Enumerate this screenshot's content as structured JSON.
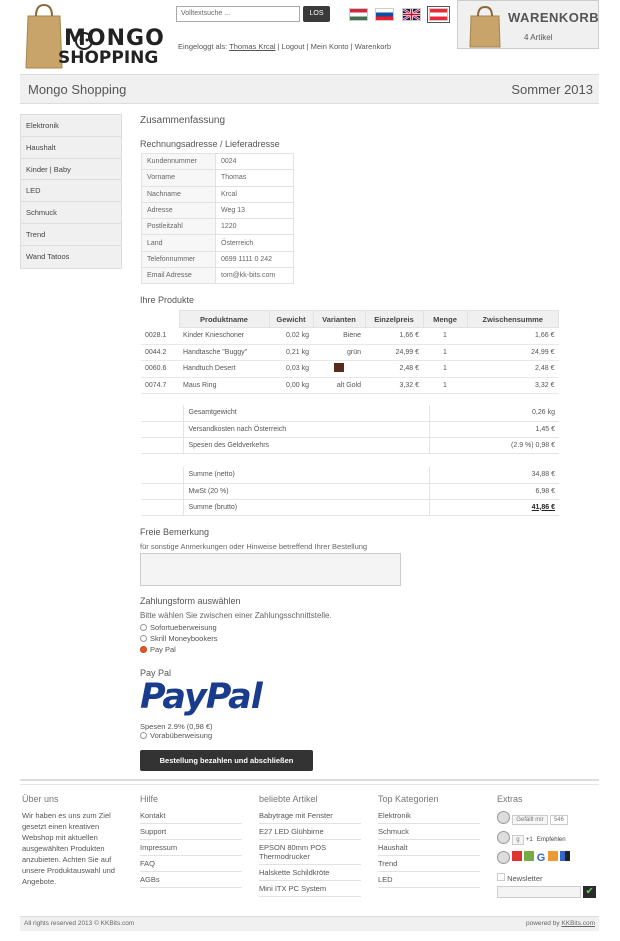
{
  "header": {
    "logo_text_top": "MONGO",
    "logo_text_bottom": "SHOPPING",
    "search_placeholder": "Volltextsuche ...",
    "search_button": "LOS",
    "flags": [
      "hungary",
      "slovakia",
      "united-kingdom",
      "austria"
    ],
    "login_prefix": "Eingeloggt als:",
    "login_user": "Thomas Krcal",
    "logout": "Logout",
    "my_account": "Mein Konto",
    "cart_link": "Warenkorb",
    "cart_title": "WARENKORB",
    "cart_count": "4 Artikel"
  },
  "titlebar": {
    "left": "Mongo Shopping",
    "right": "Sommer 2013"
  },
  "sidebar": {
    "items": [
      "Elektronik",
      "Haushalt",
      "Kinder | Baby",
      "LED",
      "Schmuck",
      "Trend",
      "Wand Tatoos"
    ]
  },
  "main": {
    "heading": "Zusammenfassung",
    "address_heading": "Rechnungsadresse / Lieferadresse",
    "address": [
      {
        "label": "Kundennummer",
        "value": "0024"
      },
      {
        "label": "Vorname",
        "value": "Thomas"
      },
      {
        "label": "Nachname",
        "value": "Krcal"
      },
      {
        "label": "Adresse",
        "value": "Weg 13"
      },
      {
        "label": "Postleitzahl",
        "value": "1220"
      },
      {
        "label": "Land",
        "value": "Österreich"
      },
      {
        "label": "Telefonnummer",
        "value": "0699 1111 0 242"
      },
      {
        "label": "Email Adresse",
        "value": "tom@kk-bits.com"
      }
    ],
    "products_heading": "Ihre Produkte",
    "products_columns": [
      "Produktname",
      "Gewicht",
      "Varianten",
      "Einzelpreis",
      "Menge",
      "Zwischensumme"
    ],
    "products": [
      {
        "nr": "0028.1",
        "name": "Kinder Knieschoner",
        "weight": "0,02 kg",
        "variant": "Biene",
        "price": "1,66 €",
        "qty": "1",
        "subtotal": "1,66 €"
      },
      {
        "nr": "0044.2",
        "name": "Handtasche \"Buggy\"",
        "weight": "0,21 kg",
        "variant": "grün",
        "price": "24,99 €",
        "qty": "1",
        "subtotal": "24,99 €"
      },
      {
        "nr": "0060.6",
        "name": "Handtuch Desert",
        "weight": "0,03 kg",
        "variant": "",
        "price": "2,48 €",
        "qty": "1",
        "subtotal": "2,48 €"
      },
      {
        "nr": "0074.7",
        "name": "Maus Ring",
        "weight": "0,00 kg",
        "variant": "alt Gold",
        "price": "3,32 €",
        "qty": "1",
        "subtotal": "3,32 €"
      }
    ],
    "variant_swatch_color": "#5a2b1a",
    "summary_a": [
      {
        "label": "Gesamtgewicht",
        "value": "0,26 kg"
      },
      {
        "label": "Versandkosten nach Österreich",
        "value": "1,45 €"
      },
      {
        "label": "Spesen des Geldverkehrs",
        "value": "(2.9 %) 0,98 €"
      }
    ],
    "summary_b": [
      {
        "label": "Summe (netto)",
        "value": "34,88 €"
      },
      {
        "label": "MwSt (20 %)",
        "value": "6,98 €"
      },
      {
        "label": "Summe (brutto)",
        "value": "41,86 €"
      }
    ],
    "remark_heading": "Freie Bemerkung",
    "remark_hint": "für sonstige Anmerkungen oder Hinweise betreffend Ihrer Bestellung",
    "payment_heading": "Zahlungsform auswählen",
    "payment_hint": "Bitte wählen Sie zwischen einer Zahlungsschnittstelle.",
    "payment_options": [
      "Sofortueberweisung",
      "Skrill Moneybookers",
      "Pay Pal"
    ],
    "payment_selected": "Pay Pal",
    "paypal_label": "Pay Pal",
    "paypal_logo_text": "PayPal",
    "fees": "Spesen 2.9% (0,98 €)",
    "prepay": "Vorabüberweisung",
    "submit": "Bestellung bezahlen und abschließen"
  },
  "footer": {
    "about_title": "Über uns",
    "about_text": "Wir haben es uns zum Ziel gesetzt einen kreativen Webshop mit aktuellen ausgewählten Produkten anzubieten. Achten Sie auf unsere Produktauswahl und Angebote.",
    "help_title": "Hilfe",
    "help_items": [
      "Kontakt",
      "Support",
      "Impressum",
      "FAQ",
      "AGBs"
    ],
    "popular_title": "beliebte Artikel",
    "popular_items": [
      "Babytrage mit Fenster",
      "E27 LED Glühbirne",
      "EPSON 80mm POS Thermodrucker",
      "Halskette Schildkröte",
      "Mini ITX PC System"
    ],
    "top_title": "Top Kategorien",
    "top_items": [
      "Elektronik",
      "Schmuck",
      "Haushalt",
      "Trend",
      "LED"
    ],
    "extras_title": "Extras",
    "like_label": "Gefällt mir",
    "like_count": "546",
    "plus_label": "+1",
    "recommend_label": "Empfehlen",
    "newsletter_label": "Newsletter",
    "copyright": "All rights reserved 2013 © KKBits.com",
    "powered_prefix": "powered by",
    "powered_link": "KKBits.com"
  }
}
